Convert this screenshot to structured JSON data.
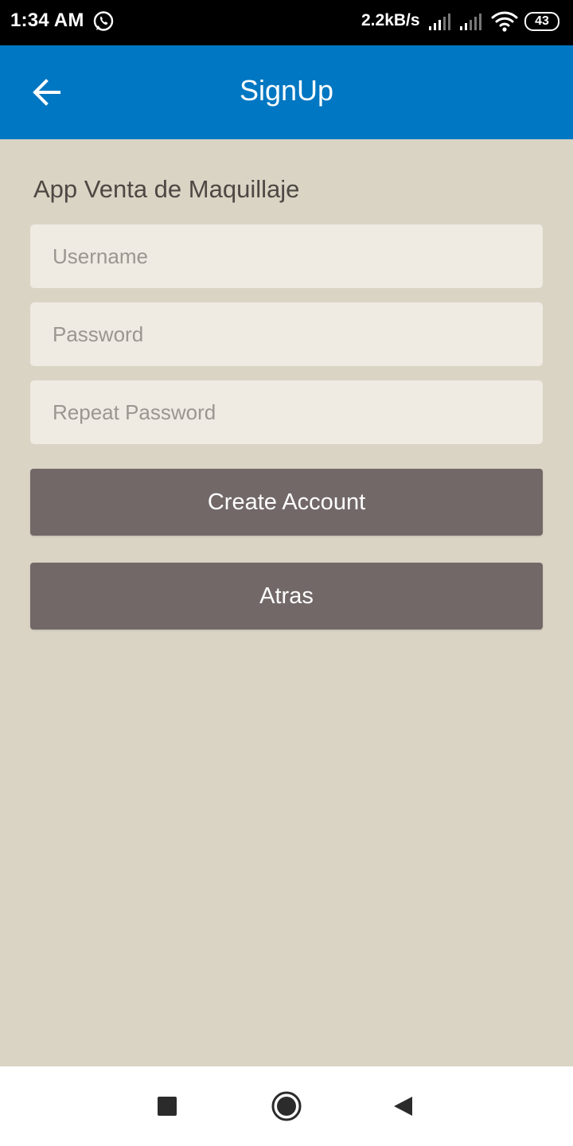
{
  "status_bar": {
    "time": "1:34 AM",
    "network_speed": "2.2kB/s",
    "battery_level": "43",
    "icons": [
      "whatsapp-icon",
      "signal-icon",
      "signal-icon",
      "wifi-icon",
      "battery-icon"
    ]
  },
  "app_bar": {
    "title": "SignUp",
    "back_icon": "arrow-left-icon",
    "background_color": "#0077c2"
  },
  "form": {
    "brand_text": "App Venta de Maquillaje",
    "username_placeholder": "Username",
    "username_value": "",
    "password_placeholder": "Password",
    "password_value": "",
    "repeat_password_placeholder": "Repeat Password",
    "repeat_password_value": ""
  },
  "buttons": {
    "create_account_label": "Create Account",
    "atras_label": "Atras",
    "button_color": "#726868"
  },
  "nav_bar": {
    "icons": [
      "recents-square-icon",
      "home-circle-icon",
      "back-triangle-icon"
    ]
  },
  "colors": {
    "background": "#dad4c5",
    "field_background": "#efebe3"
  }
}
